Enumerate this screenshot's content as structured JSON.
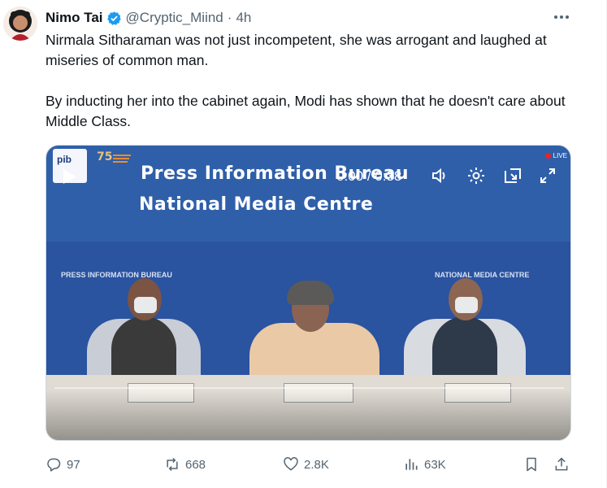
{
  "author": {
    "name": "Nimo Tai",
    "handle": "@Cryptic_Miind",
    "separator": "·",
    "time": "4h"
  },
  "tweet": {
    "paragraphs": [
      "Nirmala Sitharaman was not just incompetent, she was arrogant and laughed at miseries of common man.",
      "By inducting her into the cabinet again, Modi has shown that he doesn't care about Middle Class."
    ]
  },
  "media": {
    "banner_line1": "Press Information Bureau",
    "banner_line2": "National Media Centre",
    "logo_text": "pib",
    "live_text": "LIVE",
    "player": {
      "time_current": "0:00",
      "time_separator": "/",
      "time_total": "0:38",
      "progress": 0
    }
  },
  "actions": {
    "replies": "97",
    "reposts": "668",
    "likes": "2.8K",
    "views": "63K"
  },
  "colors": {
    "accent": "#1d9bf0",
    "muted": "#536471",
    "text": "#0f1419"
  }
}
